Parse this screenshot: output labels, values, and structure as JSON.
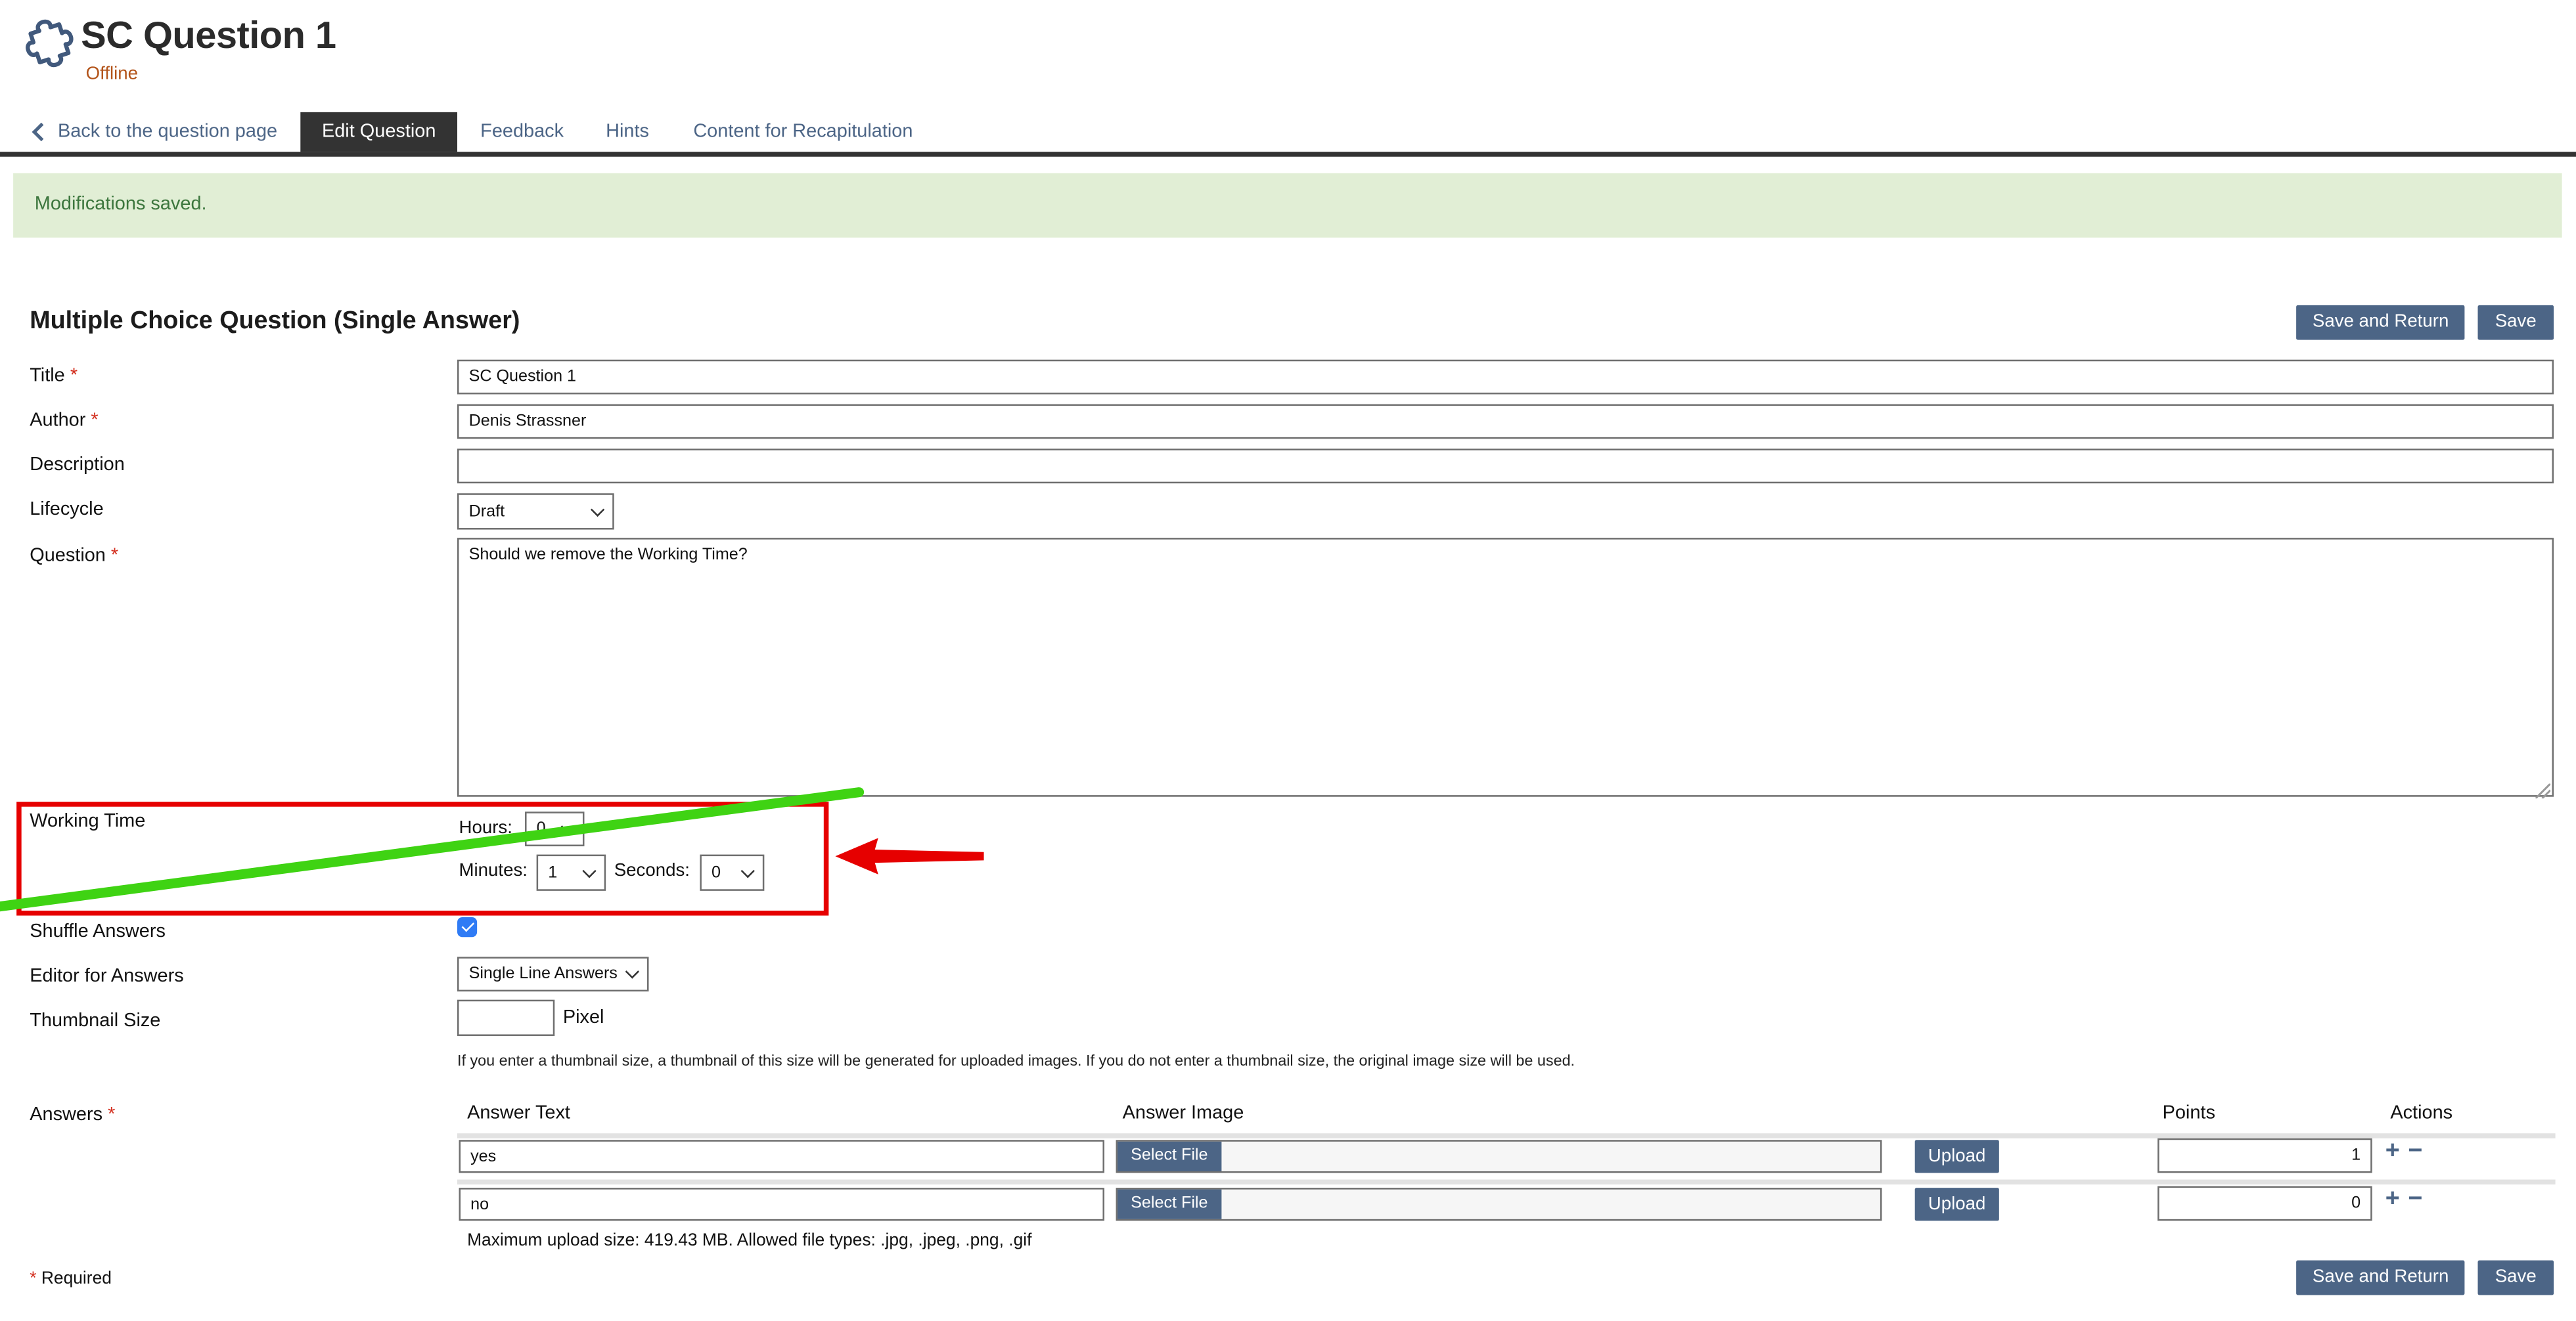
{
  "page": {
    "title": "SC Question 1",
    "status": "Offline"
  },
  "tabs": {
    "back_label": "Back to the question page",
    "active": "Edit Question",
    "others": [
      "Feedback",
      "Hints",
      "Content for Recapitulation"
    ]
  },
  "banner": {
    "message": "Modifications saved."
  },
  "form": {
    "heading": "Multiple Choice Question (Single Answer)",
    "buttons": {
      "save_and_return": "Save and Return",
      "save": "Save"
    },
    "required_mark": "*",
    "required_note": "Required",
    "fields": {
      "title": {
        "label": "Title",
        "value": "SC Question 1"
      },
      "author": {
        "label": "Author",
        "value": "Denis Strassner"
      },
      "description": {
        "label": "Description",
        "value": ""
      },
      "lifecycle": {
        "label": "Lifecycle",
        "value": "Draft"
      },
      "question": {
        "label": "Question",
        "value": "Should we remove the Working Time?"
      },
      "working_time": {
        "label": "Working Time",
        "hours_label": "Hours:",
        "hours_value": "0",
        "minutes_label": "Minutes:",
        "minutes_value": "1",
        "seconds_label": "Seconds:",
        "seconds_value": "0"
      },
      "shuffle": {
        "label": "Shuffle Answers",
        "checked": true
      },
      "editor": {
        "label": "Editor for Answers",
        "value": "Single Line Answers"
      },
      "thumbnail": {
        "label": "Thumbnail Size",
        "value": "",
        "unit": "Pixel",
        "help": "If you enter a thumbnail size, a thumbnail of this size will be generated for uploaded images. If you do not enter a thumbnail size, the original image size will be used."
      }
    },
    "answers": {
      "label": "Answers",
      "columns": {
        "text": "Answer Text",
        "image": "Answer Image",
        "points": "Points",
        "actions": "Actions"
      },
      "select_file_label": "Select File",
      "upload_label": "Upload",
      "rows": [
        {
          "text": "yes",
          "points": "1"
        },
        {
          "text": "no",
          "points": "0"
        }
      ],
      "upload_note": "Maximum upload size: 419.43 MB. Allowed file types: .jpg, .jpeg, .png, .gif"
    }
  },
  "icons": {
    "plus": "+",
    "minus": "−",
    "puzzle": "puzzle-piece-outline",
    "back_chevron": "chevron-left",
    "select_chevron": "chevron-down",
    "checkmark": "check"
  },
  "annotations": {
    "red_box": {
      "shape": "rectangle",
      "color": "#e60000",
      "target": "working-time-row"
    },
    "green_line": {
      "shape": "diagonal-strike-line",
      "color": "#3fd313"
    },
    "red_arrow": {
      "shape": "arrow-left",
      "color": "#e60000"
    }
  },
  "colors": {
    "accent": "#4c6586",
    "active_tab": "#333333",
    "success_bg": "#e1eed5",
    "success_text": "#3c763d",
    "offline_text": "#b3541a",
    "required": "#d32f1f",
    "checkbox": "#2f7bf5"
  }
}
